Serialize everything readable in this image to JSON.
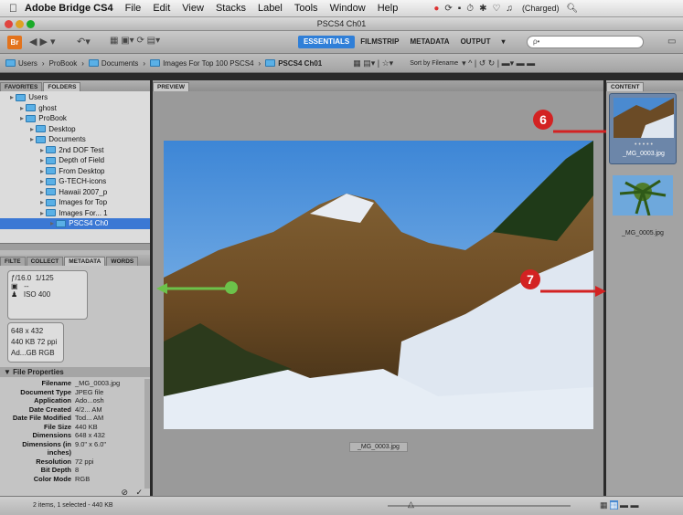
{
  "menubar": {
    "app_name": "Adobe Bridge CS4",
    "items": [
      "File",
      "Edit",
      "View",
      "Stacks",
      "Label",
      "Tools",
      "Window",
      "Help"
    ],
    "battery": "(Charged)"
  },
  "window": {
    "title": "PSCS4 Ch01"
  },
  "toolbar": {
    "logo": "Br",
    "workspaces": [
      "ESSENTIALS",
      "FILMSTRIP",
      "METADATA",
      "OUTPUT"
    ],
    "search_placeholder": "ρ•"
  },
  "path_bar": {
    "crumbs": [
      "Users",
      "ProBook",
      "Documents",
      "Images For Top 100 PSCS4",
      "PSCS4 Ch01"
    ],
    "sort_label": "Sort by Filename"
  },
  "left_panel": {
    "tabs": [
      "FAVORITES",
      "FOLDERS"
    ],
    "tree": [
      {
        "label": "Users",
        "indent": 1
      },
      {
        "label": "ghost",
        "indent": 2
      },
      {
        "label": "ProBook",
        "indent": 2
      },
      {
        "label": "Desktop",
        "indent": 3
      },
      {
        "label": "Documents",
        "indent": 3
      },
      {
        "label": "2nd DOF Test",
        "indent": 4
      },
      {
        "label": "Depth of Field",
        "indent": 4
      },
      {
        "label": "From Desktop",
        "indent": 4
      },
      {
        "label": "G-TECH-icons",
        "indent": 4
      },
      {
        "label": "Hawaii 2007_p",
        "indent": 4
      },
      {
        "label": "Images for Top",
        "indent": 4
      },
      {
        "label": "Images For... 1",
        "indent": 4
      },
      {
        "label": "PSCS4 Ch0",
        "indent": 5
      }
    ]
  },
  "meta_panel": {
    "tabs": [
      "FILTE",
      "COLLECT",
      "METADATA",
      "WORDS"
    ],
    "aperture": "ƒ/16.0",
    "shutter": "1/125",
    "dash": "--",
    "iso": "ISO 400",
    "dims": "648 x 432",
    "size_res": "440 KB   72 ppi",
    "profile": "Ad...GB  RGB",
    "section": "File Properties",
    "rows": [
      {
        "k": "Filename",
        "v": "_MG_0003.jpg"
      },
      {
        "k": "Document Type",
        "v": "JPEG file"
      },
      {
        "k": "Application",
        "v": "Ado...osh"
      },
      {
        "k": "Date Created",
        "v": "4/2... AM"
      },
      {
        "k": "Date File Modified",
        "v": "Tod... AM"
      },
      {
        "k": "File Size",
        "v": "440 KB"
      },
      {
        "k": "Dimensions",
        "v": "648 x 432"
      },
      {
        "k": "Dimensions (in inches)",
        "v": "9.0\" x 6.0\""
      },
      {
        "k": "Resolution",
        "v": "72 ppi"
      },
      {
        "k": "Bit Depth",
        "v": "8"
      },
      {
        "k": "Color Mode",
        "v": "RGB"
      }
    ]
  },
  "preview": {
    "label": "PREVIEW",
    "filename": "_MG_0003.jpg"
  },
  "content": {
    "label": "CONTENT",
    "thumbs": [
      "_MG_0003.jpg",
      "_MG_0005.jpg"
    ]
  },
  "status": {
    "text": "2 items, 1 selected - 440 KB"
  },
  "callouts": {
    "six": "6",
    "seven": "7"
  }
}
